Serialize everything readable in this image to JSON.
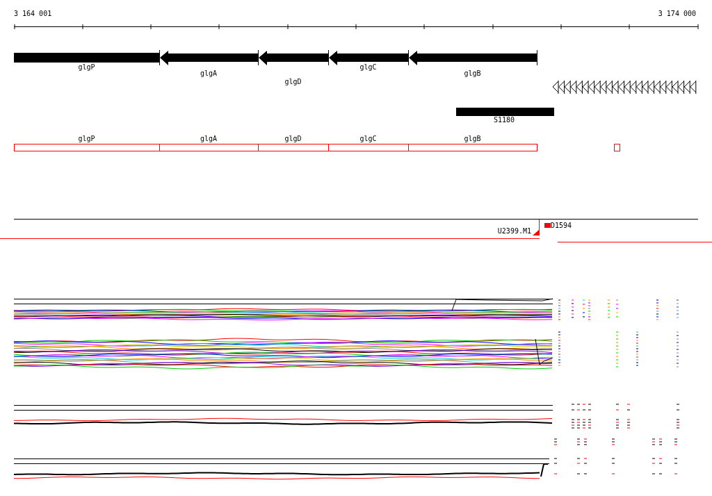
{
  "ruler": {
    "start_label": "3 164 001",
    "end_label": "3 174 000"
  },
  "genes": [
    {
      "name": "glgP",
      "kind": "block"
    },
    {
      "name": "glgA",
      "kind": "arrow"
    },
    {
      "name": "glgD",
      "kind": "arrow"
    },
    {
      "name": "glgC",
      "kind": "arrow"
    },
    {
      "name": "glgB",
      "kind": "arrow"
    }
  ],
  "features": [
    {
      "name": "S1180"
    }
  ],
  "annotations": [
    {
      "name": "glgP"
    },
    {
      "name": "glgA"
    },
    {
      "name": "glgD"
    },
    {
      "name": "glgC"
    },
    {
      "name": "glgB"
    }
  ],
  "markers": [
    {
      "name": "U2399.M1",
      "kind": "left"
    },
    {
      "name": "D1594",
      "kind": "right"
    }
  ]
}
